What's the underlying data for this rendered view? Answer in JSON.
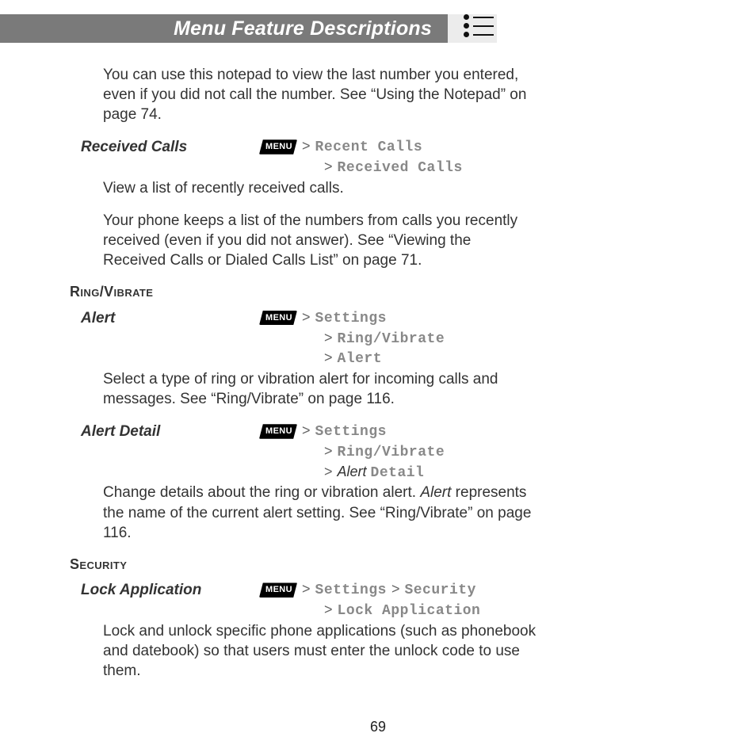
{
  "header": {
    "title": "Menu Feature Descriptions"
  },
  "menuKeyLabel": "MENU",
  "pageNumber": "69",
  "intro": "You can use this notepad to view the last number you entered, even if you did not call the number. See “Using the Notepad” on page 74.",
  "receivedCalls": {
    "name": "Received Calls",
    "path1": "Recent Calls",
    "path2": "Received Calls",
    "p1": "View a list of recently received calls.",
    "p2": "Your phone keeps a list of the numbers from calls you recently received (even if you did not answer). See “Viewing the Received Calls or Dialed Calls List” on page 71."
  },
  "ringVibrateHeading": "Ring/Vibrate",
  "alert": {
    "name": "Alert",
    "path1": "Settings",
    "path2": "Ring/Vibrate",
    "path3": "Alert",
    "p": "Select a type of ring or vibration alert for incoming calls and messages. See “Ring/Vibrate” on page 116."
  },
  "alertDetail": {
    "name": "Alert Detail",
    "path1": "Settings",
    "path2": "Ring/Vibrate",
    "path3ItalicPrefix": "Alert",
    "path3Mono": "Detail",
    "pPart1": "Change details about the ring or vibration alert. ",
    "pItalic": "Alert",
    "pPart2": " represents the name of the current alert setting. See “Ring/Vibrate” on page 116."
  },
  "securityHeading": "Security",
  "lockApp": {
    "name": "Lock Application",
    "path1": "Settings",
    "path2": "Security",
    "path3": "Lock Application",
    "p": "Lock and unlock specific phone applications (such as phonebook and datebook) so that users must enter the unlock code to use them."
  }
}
